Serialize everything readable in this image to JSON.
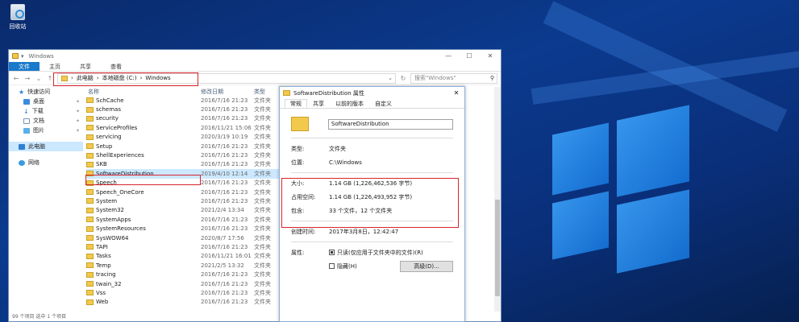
{
  "desktop": {
    "recycle_bin_label": "回收站"
  },
  "explorer": {
    "title": "Windows",
    "window_controls": {
      "minimize": "—",
      "maximize": "☐",
      "close": "✕"
    },
    "ribbon_tabs": [
      "文件",
      "主页",
      "共享",
      "查看"
    ],
    "address": {
      "crumbs": [
        "此电脑",
        "本地磁盘 (C:)",
        "Windows"
      ],
      "separator": "›"
    },
    "search_placeholder": "搜索\"Windows\"",
    "sidebar": [
      {
        "label": "快速访问",
        "icon": "star-icon",
        "sub": false,
        "pinned": false
      },
      {
        "label": "桌面",
        "icon": "desktop-icon",
        "sub": true,
        "pinned": true
      },
      {
        "label": "下载",
        "icon": "download-icon",
        "sub": true,
        "pinned": true
      },
      {
        "label": "文档",
        "icon": "document-icon",
        "sub": true,
        "pinned": true
      },
      {
        "label": "图片",
        "icon": "pictures-icon",
        "sub": true,
        "pinned": true
      },
      {
        "label": "此电脑",
        "icon": "computer-icon",
        "sub": false,
        "pinned": false,
        "selected": true
      },
      {
        "label": "网络",
        "icon": "network-icon",
        "sub": false,
        "pinned": false
      }
    ],
    "columns": {
      "name": "名称",
      "date": "修改日期",
      "type": "类型"
    },
    "files": [
      {
        "name": "SchCache",
        "date": "2016/7/16 21:23",
        "type": "文件夹"
      },
      {
        "name": "schemas",
        "date": "2016/7/16 21:23",
        "type": "文件夹"
      },
      {
        "name": "security",
        "date": "2016/7/16 21:23",
        "type": "文件夹"
      },
      {
        "name": "ServiceProfiles",
        "date": "2016/11/21 15:06",
        "type": "文件夹"
      },
      {
        "name": "servicing",
        "date": "2020/3/19 10:19",
        "type": "文件夹"
      },
      {
        "name": "Setup",
        "date": "2016/7/16 21:23",
        "type": "文件夹"
      },
      {
        "name": "ShellExperiences",
        "date": "2016/7/16 21:23",
        "type": "文件夹"
      },
      {
        "name": "SKB",
        "date": "2016/7/16 21:23",
        "type": "文件夹"
      },
      {
        "name": "SoftwareDistribution",
        "date": "2019/4/10 12:14",
        "type": "文件夹",
        "selected": true
      },
      {
        "name": "Speech",
        "date": "2016/7/16 21:23",
        "type": "文件夹"
      },
      {
        "name": "Speech_OneCore",
        "date": "2016/7/16 21:23",
        "type": "文件夹"
      },
      {
        "name": "System",
        "date": "2016/7/16 21:23",
        "type": "文件夹"
      },
      {
        "name": "System32",
        "date": "2021/2/4 13:34",
        "type": "文件夹"
      },
      {
        "name": "SystemApps",
        "date": "2016/7/16 21:23",
        "type": "文件夹"
      },
      {
        "name": "SystemResources",
        "date": "2016/7/16 21:23",
        "type": "文件夹"
      },
      {
        "name": "SysWOW64",
        "date": "2020/8/7 17:56",
        "type": "文件夹"
      },
      {
        "name": "TAPI",
        "date": "2016/7/16 21:23",
        "type": "文件夹"
      },
      {
        "name": "Tasks",
        "date": "2016/11/21 16:01",
        "type": "文件夹"
      },
      {
        "name": "Temp",
        "date": "2021/2/5 13:32",
        "type": "文件夹"
      },
      {
        "name": "tracing",
        "date": "2016/7/16 21:23",
        "type": "文件夹"
      },
      {
        "name": "twain_32",
        "date": "2016/7/16 21:23",
        "type": "文件夹"
      },
      {
        "name": "Vss",
        "date": "2016/7/16 21:23",
        "type": "文件夹"
      },
      {
        "name": "Web",
        "date": "2016/7/16 21:23",
        "type": "文件夹"
      }
    ],
    "status": "99 个项目   选中 1 个项目"
  },
  "properties": {
    "title": "SoftwareDistribution 属性",
    "close": "✕",
    "tabs": [
      "常规",
      "共享",
      "以前的版本",
      "自定义"
    ],
    "name_value": "SoftwareDistribution",
    "type_label": "类型:",
    "type_value": "文件夹",
    "location_label": "位置:",
    "location_value": "C:\\Windows",
    "size_label": "大小:",
    "size_value": "1.14 GB (1,226,462,536 字节)",
    "disk_label": "占用空间:",
    "disk_value": "1.14 GB (1,226,493,952 字节)",
    "contains_label": "包含:",
    "contains_value": "33 个文件，12 个文件夹",
    "created_label": "创建时间:",
    "created_value": "2017年3月8日，12:42:47",
    "attr_label": "属性:",
    "readonly_label": "只读(仅应用于文件夹中的文件)(R)",
    "hidden_label": "隐藏(H)",
    "advanced_label": "高级(D)..."
  },
  "colors": {
    "highlight_red": "#d9232e",
    "selection": "#cce8ff",
    "file_tab": "#1979ca"
  }
}
